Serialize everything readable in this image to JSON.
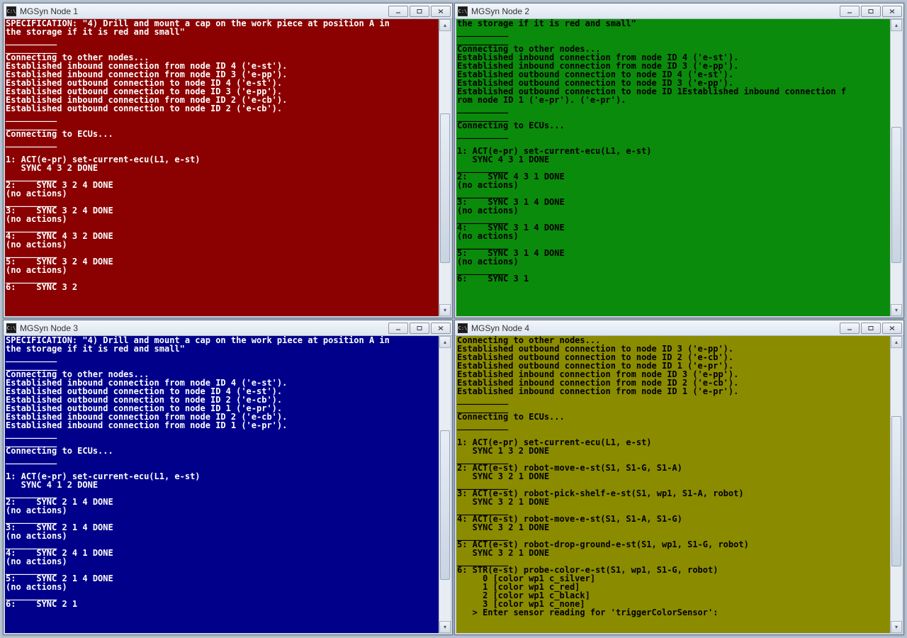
{
  "windows": [
    {
      "title": "MGSyn Node 1",
      "theme": "t1",
      "thumb_top": "30%",
      "thumb_height": "55%",
      "lines": [
        "SPECIFICATION: \"4) Drill and mount a cap on the work piece at position A in",
        "the storage if it is red and small\"",
        "__________",
        "__________",
        "Connecting to other nodes...",
        "Established inbound connection from node ID 4 ('e-st').",
        "Established inbound connection from node ID 3 ('e-pp').",
        "Established outbound connection to node ID 4 ('e-st').",
        "Established outbound connection to node ID 3 ('e-pp').",
        "Established inbound connection from node ID 2 ('e-cb').",
        "Established outbound connection to node ID 2 ('e-cb').",
        "__________",
        "__________",
        "Connecting to ECUs...",
        "__________",
        "",
        "1: ACT(e-pr) set-current-ecu(L1, e-st)",
        "   SYNC 4 3 2 DONE",
        "__________",
        "2:    SYNC 3 2 4 DONE",
        "(no actions)",
        "__________",
        "3:    SYNC 3 2 4 DONE",
        "(no actions)",
        "__________",
        "4:    SYNC 4 3 2 DONE",
        "(no actions)",
        "__________",
        "5:    SYNC 3 2 4 DONE",
        "(no actions)",
        "__________",
        "6:    SYNC 3 2"
      ]
    },
    {
      "title": "MGSyn Node 2",
      "theme": "t2",
      "thumb_top": "35%",
      "thumb_height": "50%",
      "lines": [
        "the storage if it is red and small\"",
        "__________",
        "__________",
        "Connecting to other nodes...",
        "Established inbound connection from node ID 4 ('e-st').",
        "Established inbound connection from node ID 3 ('e-pp').",
        "Established outbound connection to node ID 4 ('e-st').",
        "Established outbound connection to node ID 3 ('e-pp').",
        "Established outbound connection to node ID 1Established inbound connection f",
        "rom node ID 1 ('e-pr'). ('e-pr').",
        "__________",
        "__________",
        "Connecting to ECUs...",
        "__________",
        "",
        "1: ACT(e-pr) set-current-ecu(L1, e-st)",
        "   SYNC 4 3 1 DONE",
        "__________",
        "2:    SYNC 4 3 1 DONE",
        "(no actions)",
        "__________",
        "3:    SYNC 3 1 4 DONE",
        "(no actions)",
        "__________",
        "4:    SYNC 3 1 4 DONE",
        "(no actions)",
        "__________",
        "5:    SYNC 3 1 4 DONE",
        "(no actions)",
        "__________",
        "6:    SYNC 3 1"
      ]
    },
    {
      "title": "MGSyn Node 3",
      "theme": "t3",
      "thumb_top": "30%",
      "thumb_height": "55%",
      "lines": [
        "SPECIFICATION: \"4) Drill and mount a cap on the work piece at position A in",
        "the storage if it is red and small\"",
        "__________",
        "__________",
        "Connecting to other nodes...",
        "Established inbound connection from node ID 4 ('e-st').",
        "Established outbound connection to node ID 4 ('e-st').",
        "Established outbound connection to node ID 2 ('e-cb').",
        "Established outbound connection to node ID 1 ('e-pr').",
        "Established inbound connection from node ID 2 ('e-cb').",
        "Established inbound connection from node ID 1 ('e-pr').",
        "__________",
        "__________",
        "Connecting to ECUs...",
        "__________",
        "",
        "1: ACT(e-pr) set-current-ecu(L1, e-st)",
        "   SYNC 4 1 2 DONE",
        "__________",
        "2:    SYNC 2 1 4 DONE",
        "(no actions)",
        "__________",
        "3:    SYNC 2 1 4 DONE",
        "(no actions)",
        "__________",
        "4:    SYNC 2 4 1 DONE",
        "(no actions)",
        "__________",
        "5:    SYNC 2 1 4 DONE",
        "(no actions)",
        "__________",
        "6:    SYNC 2 1"
      ]
    },
    {
      "title": "MGSyn Node 4",
      "theme": "t4",
      "thumb_top": "25%",
      "thumb_height": "55%",
      "lines": [
        "Connecting to other nodes...",
        "Established outbound connection to node ID 3 ('e-pp').",
        "Established outbound connection to node ID 2 ('e-cb').",
        "Established outbound connection to node ID 1 ('e-pr').",
        "Established inbound connection from node ID 3 ('e-pp').",
        "Established inbound connection from node ID 2 ('e-cb').",
        "Established inbound connection from node ID 1 ('e-pr').",
        "__________",
        "__________",
        "Connecting to ECUs...",
        "__________",
        "",
        "1: ACT(e-pr) set-current-ecu(L1, e-st)",
        "   SYNC 1 3 2 DONE",
        "__________",
        "2: ACT(e-st) robot-move-e-st(S1, S1-G, S1-A)",
        "   SYNC 3 2 1 DONE",
        "__________",
        "3: ACT(e-st) robot-pick-shelf-e-st(S1, wp1, S1-A, robot)",
        "   SYNC 3 2 1 DONE",
        "__________",
        "4: ACT(e-st) robot-move-e-st(S1, S1-A, S1-G)",
        "   SYNC 3 2 1 DONE",
        "__________",
        "5: ACT(e-st) robot-drop-ground-e-st(S1, wp1, S1-G, robot)",
        "   SYNC 3 2 1 DONE",
        "__________",
        "6: STR(e-st) probe-color-e-st(S1, wp1, S1-G, robot)",
        "     0 [color wp1 c_silver]",
        "     1 [color wp1 c_red]",
        "     2 [color wp1 c_black]",
        "     3 [color wp1 c_none]",
        "   > Enter sensor reading for 'triggerColorSensor':"
      ]
    }
  ],
  "icon_label": "C:\\"
}
